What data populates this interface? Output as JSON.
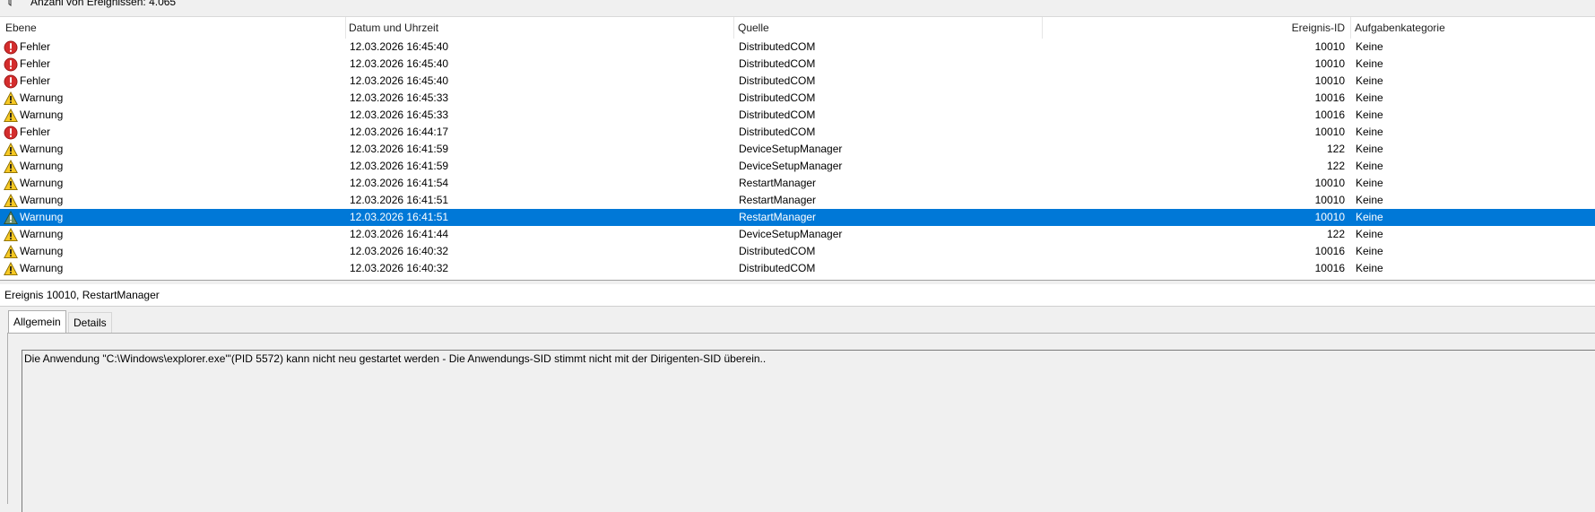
{
  "toolbar": {
    "event_count_label": "Anzahl von Ereignissen: 4.065"
  },
  "table": {
    "columns": [
      "Ebene",
      "Datum und Uhrzeit",
      "Quelle",
      "Ereignis-ID",
      "Aufgabenkategorie"
    ],
    "rows": [
      {
        "level": "Fehler",
        "type": "error",
        "date": "12.03.2026 16:45:40",
        "source": "DistributedCOM",
        "id": "10010",
        "category": "Keine"
      },
      {
        "level": "Fehler",
        "type": "error",
        "date": "12.03.2026 16:45:40",
        "source": "DistributedCOM",
        "id": "10010",
        "category": "Keine"
      },
      {
        "level": "Fehler",
        "type": "error",
        "date": "12.03.2026 16:45:40",
        "source": "DistributedCOM",
        "id": "10010",
        "category": "Keine"
      },
      {
        "level": "Warnung",
        "type": "warning",
        "date": "12.03.2026 16:45:33",
        "source": "DistributedCOM",
        "id": "10016",
        "category": "Keine"
      },
      {
        "level": "Warnung",
        "type": "warning",
        "date": "12.03.2026 16:45:33",
        "source": "DistributedCOM",
        "id": "10016",
        "category": "Keine"
      },
      {
        "level": "Fehler",
        "type": "error",
        "date": "12.03.2026 16:44:17",
        "source": "DistributedCOM",
        "id": "10010",
        "category": "Keine"
      },
      {
        "level": "Warnung",
        "type": "warning",
        "date": "12.03.2026 16:41:59",
        "source": "DeviceSetupManager",
        "id": "122",
        "category": "Keine"
      },
      {
        "level": "Warnung",
        "type": "warning",
        "date": "12.03.2026 16:41:59",
        "source": "DeviceSetupManager",
        "id": "122",
        "category": "Keine"
      },
      {
        "level": "Warnung",
        "type": "warning",
        "date": "12.03.2026 16:41:54",
        "source": "RestartManager",
        "id": "10010",
        "category": "Keine"
      },
      {
        "level": "Warnung",
        "type": "warning",
        "date": "12.03.2026 16:41:51",
        "source": "RestartManager",
        "id": "10010",
        "category": "Keine"
      },
      {
        "level": "Warnung",
        "type": "warning",
        "date": "12.03.2026 16:41:51",
        "source": "RestartManager",
        "id": "10010",
        "category": "Keine",
        "selected": true
      },
      {
        "level": "Warnung",
        "type": "warning",
        "date": "12.03.2026 16:41:44",
        "source": "DeviceSetupManager",
        "id": "122",
        "category": "Keine"
      },
      {
        "level": "Warnung",
        "type": "warning",
        "date": "12.03.2026 16:40:32",
        "source": "DistributedCOM",
        "id": "10016",
        "category": "Keine"
      },
      {
        "level": "Warnung",
        "type": "warning",
        "date": "12.03.2026 16:40:32",
        "source": "DistributedCOM",
        "id": "10016",
        "category": "Keine"
      }
    ]
  },
  "detail": {
    "title": "Ereignis 10010, RestartManager",
    "tabs": [
      "Allgemein",
      "Details"
    ],
    "active_tab": "Allgemein",
    "message": "Die Anwendung \"C:\\Windows\\explorer.exe\"'(PID 5572) kann  nicht neu gestartet werden - Die Anwendungs-SID stimmt nicht mit der Dirigenten-SID überein.."
  },
  "colors": {
    "selection": "#0078d7",
    "error": "#d42d2d",
    "warning": "#f7c923"
  },
  "icons": {
    "error": "error-icon",
    "warning": "warning-icon",
    "filter": "filter-icon"
  }
}
